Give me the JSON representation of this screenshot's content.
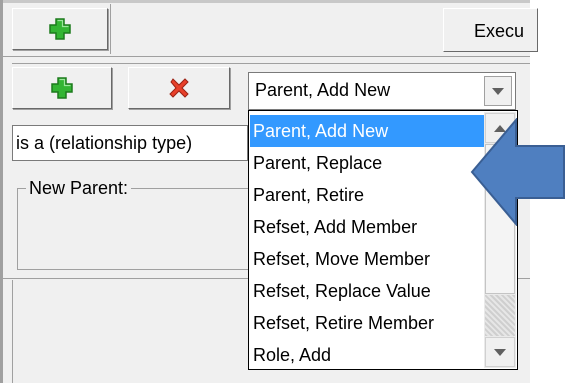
{
  "toolbar": {
    "execute_label": "Execu"
  },
  "action_row": {
    "combo_value": "Parent, Add New"
  },
  "relationship_type": {
    "value": "is a (relationship type)"
  },
  "new_parent_group": {
    "legend": "New Parent:"
  },
  "dropdown": {
    "selected_index": 0,
    "items": [
      {
        "label": "Parent, Add New"
      },
      {
        "label": "Parent, Replace"
      },
      {
        "label": "Parent, Retire"
      },
      {
        "label": "Refset, Add Member"
      },
      {
        "label": "Refset, Move Member"
      },
      {
        "label": "Refset, Replace Value"
      },
      {
        "label": "Refset, Retire Member"
      },
      {
        "label": "Role, Add"
      }
    ]
  },
  "icons": {
    "add": "plus-icon",
    "remove": "red-x-icon",
    "pointer": "blue-arrow-icon"
  },
  "colors": {
    "add_green": "#33b533",
    "remove_red": "#e8402a",
    "selection_blue": "#3399ff",
    "pointer_blue": "#4f7fc0"
  }
}
